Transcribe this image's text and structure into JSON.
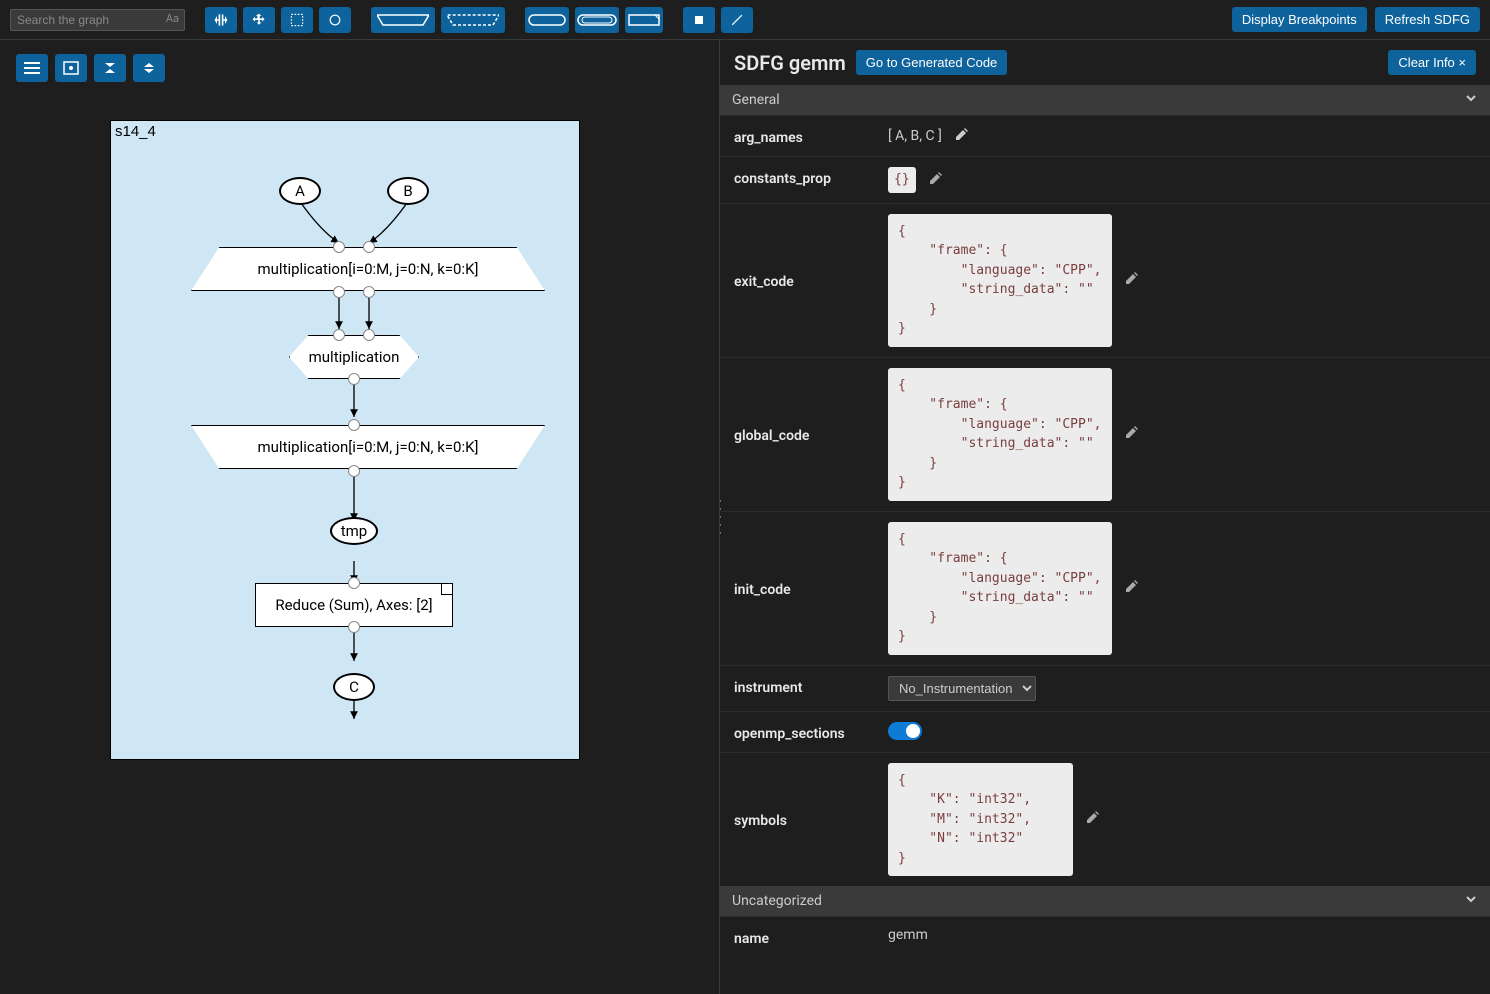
{
  "search": {
    "placeholder": "Search the graph",
    "case_label": "Aa"
  },
  "top_buttons": {
    "breakpoints": "Display Breakpoints",
    "refresh": "Refresh SDFG"
  },
  "graph": {
    "state_label": "s14_4",
    "nodes": {
      "a": "A",
      "b": "B",
      "map_entry": "multiplication[i=0:M, j=0:N, k=0:K]",
      "tasklet": "multiplication",
      "map_exit": "multiplication[i=0:M, j=0:N, k=0:K]",
      "tmp": "tmp",
      "reduce": "Reduce (Sum), Axes: [2]",
      "c": "C"
    }
  },
  "panel": {
    "title_prefix": "SDFG",
    "title_name": "gemm",
    "goto": "Go to Generated Code",
    "clear": "Clear Info ×"
  },
  "sections": {
    "general": "General",
    "uncategorized": "Uncategorized"
  },
  "props": {
    "arg_names": {
      "label": "arg_names",
      "value": "[ A, B, C ]"
    },
    "constants_prop": {
      "label": "constants_prop",
      "value": "{}"
    },
    "exit_code": {
      "label": "exit_code",
      "value": "{\n    \"frame\": {\n        \"language\": \"CPP\",\n        \"string_data\": \"\"\n    }\n}"
    },
    "global_code": {
      "label": "global_code",
      "value": "{\n    \"frame\": {\n        \"language\": \"CPP\",\n        \"string_data\": \"\"\n    }\n}"
    },
    "init_code": {
      "label": "init_code",
      "value": "{\n    \"frame\": {\n        \"language\": \"CPP\",\n        \"string_data\": \"\"\n    }\n}"
    },
    "instrument": {
      "label": "instrument",
      "value": "No_Instrumentation"
    },
    "openmp_sections": {
      "label": "openmp_sections"
    },
    "symbols": {
      "label": "symbols",
      "value": "{\n    \"K\": \"int32\",\n    \"M\": \"int32\",\n    \"N\": \"int32\"\n}"
    },
    "name": {
      "label": "name",
      "value": "gemm"
    }
  }
}
